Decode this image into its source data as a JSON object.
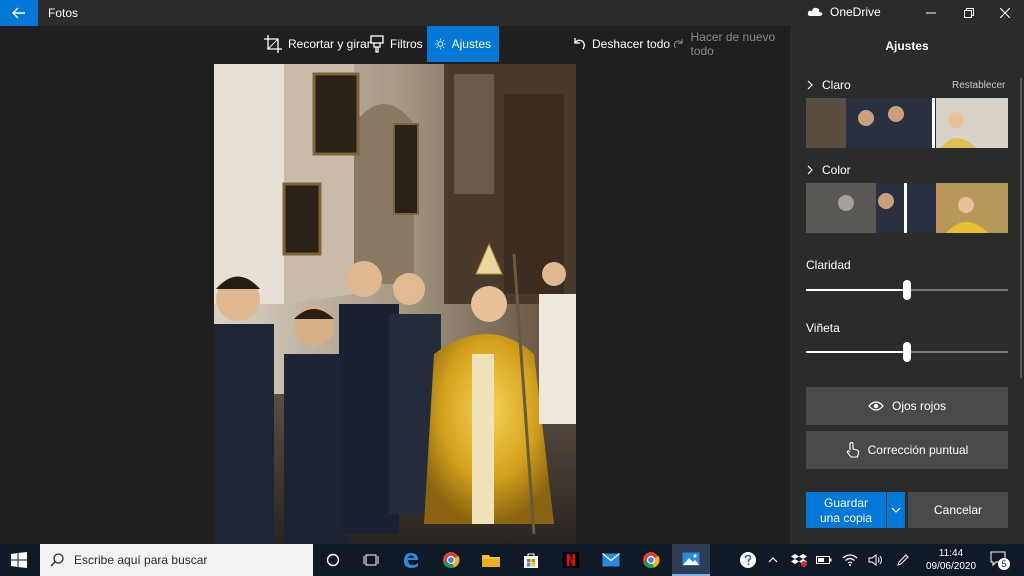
{
  "titlebar": {
    "app_title": "Fotos",
    "onedrive_label": "OneDrive"
  },
  "toolbar": {
    "crop_label": "Recortar y girar",
    "filters_label": "Filtros",
    "adjust_label": "Ajustes",
    "undo_all_label": "Deshacer todo",
    "redo_all_label": "Hacer de nuevo todo"
  },
  "panel": {
    "title": "Ajustes",
    "light_label": "Claro",
    "reset_label": "Restablecer",
    "color_label": "Color",
    "clarity_label": "Claridad",
    "clarity_value": 0.5,
    "vignette_label": "Viñeta",
    "vignette_value": 0.5,
    "red_eye_label": "Ojos rojos",
    "spot_fix_label": "Corrección puntual",
    "save_copy_label": "Guardar una copia",
    "cancel_label": "Cancelar"
  },
  "taskbar": {
    "search_placeholder": "Escribe aquí para buscar",
    "time": "11:44",
    "date": "09/06/2020",
    "notification_count": "5"
  },
  "colors": {
    "accent": "#0078d7",
    "panel_bg": "#2b2b2b",
    "canvas_bg": "#1f1f1f",
    "taskbar_bg": "#101a26"
  }
}
